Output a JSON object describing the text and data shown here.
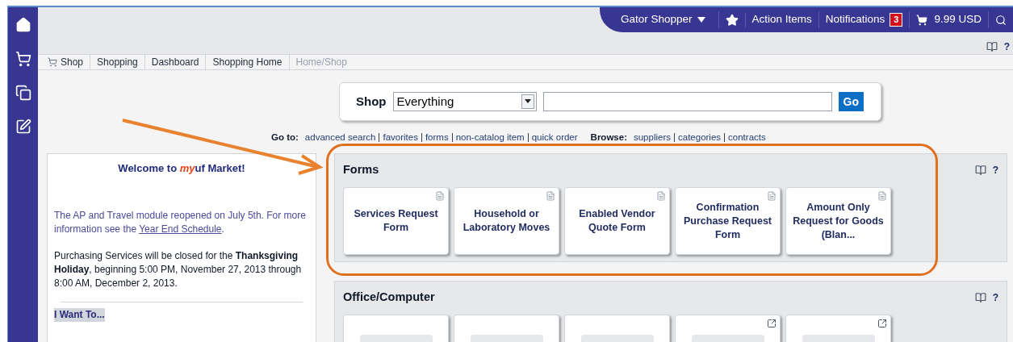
{
  "top_nav": {
    "user": "Gator Shopper",
    "items": [
      {
        "label": "Action Items"
      },
      {
        "label": "Notifications",
        "count": "3"
      }
    ],
    "cart_total": "9.99 USD",
    "help": "?"
  },
  "breadcrumb": [
    {
      "label": "Shop",
      "current": false
    },
    {
      "label": "Shopping",
      "current": false
    },
    {
      "label": "Dashboard",
      "current": false
    },
    {
      "label": "Shopping Home",
      "current": false
    },
    {
      "label": "Home/Shop",
      "current": true
    }
  ],
  "shop_search": {
    "label": "Shop",
    "category": "Everything",
    "button": "Go"
  },
  "goto": {
    "label": "Go to:",
    "links": [
      "advanced search",
      "favorites",
      "forms",
      "non-catalog item",
      "quick order"
    ]
  },
  "browse": {
    "label": "Browse:",
    "links": [
      "suppliers",
      "categories",
      "contracts"
    ]
  },
  "welcome": {
    "title": {
      "before": "Welcome to ",
      "emphasis": "my",
      "after": "uf Market!"
    },
    "notice": {
      "before": "The AP and Travel module reopened on July 5th. For more information see the ",
      "link": "Year End Schedule",
      "after": "."
    },
    "closure": "Purchasing Services will be closed for the **Thanksgiving Holiday**, beginning 5:00 PM, November 27, 2013 through 8:00 AM, December 2, 2013.",
    "i_want_to": "I Want To..."
  },
  "panels": [
    {
      "title": "Forms",
      "help": "?",
      "tiles": [
        {
          "kind": "form",
          "label": "Services Request Form"
        },
        {
          "kind": "form",
          "label": "Household or Laboratory Moves"
        },
        {
          "kind": "form",
          "label": "Enabled Vendor Quote Form"
        },
        {
          "kind": "form",
          "label": "Confirmation Purchase Request Form"
        },
        {
          "kind": "form",
          "label": "Amount Only Request for Goods (Blan..."
        }
      ]
    },
    {
      "title": "Office/Computer",
      "help": "?",
      "tiles": [
        {
          "kind": "logo",
          "external": false
        },
        {
          "kind": "logo",
          "external": false
        },
        {
          "kind": "logo",
          "external": false
        },
        {
          "kind": "logo",
          "external": true
        },
        {
          "kind": "logo",
          "external": true
        }
      ]
    }
  ]
}
